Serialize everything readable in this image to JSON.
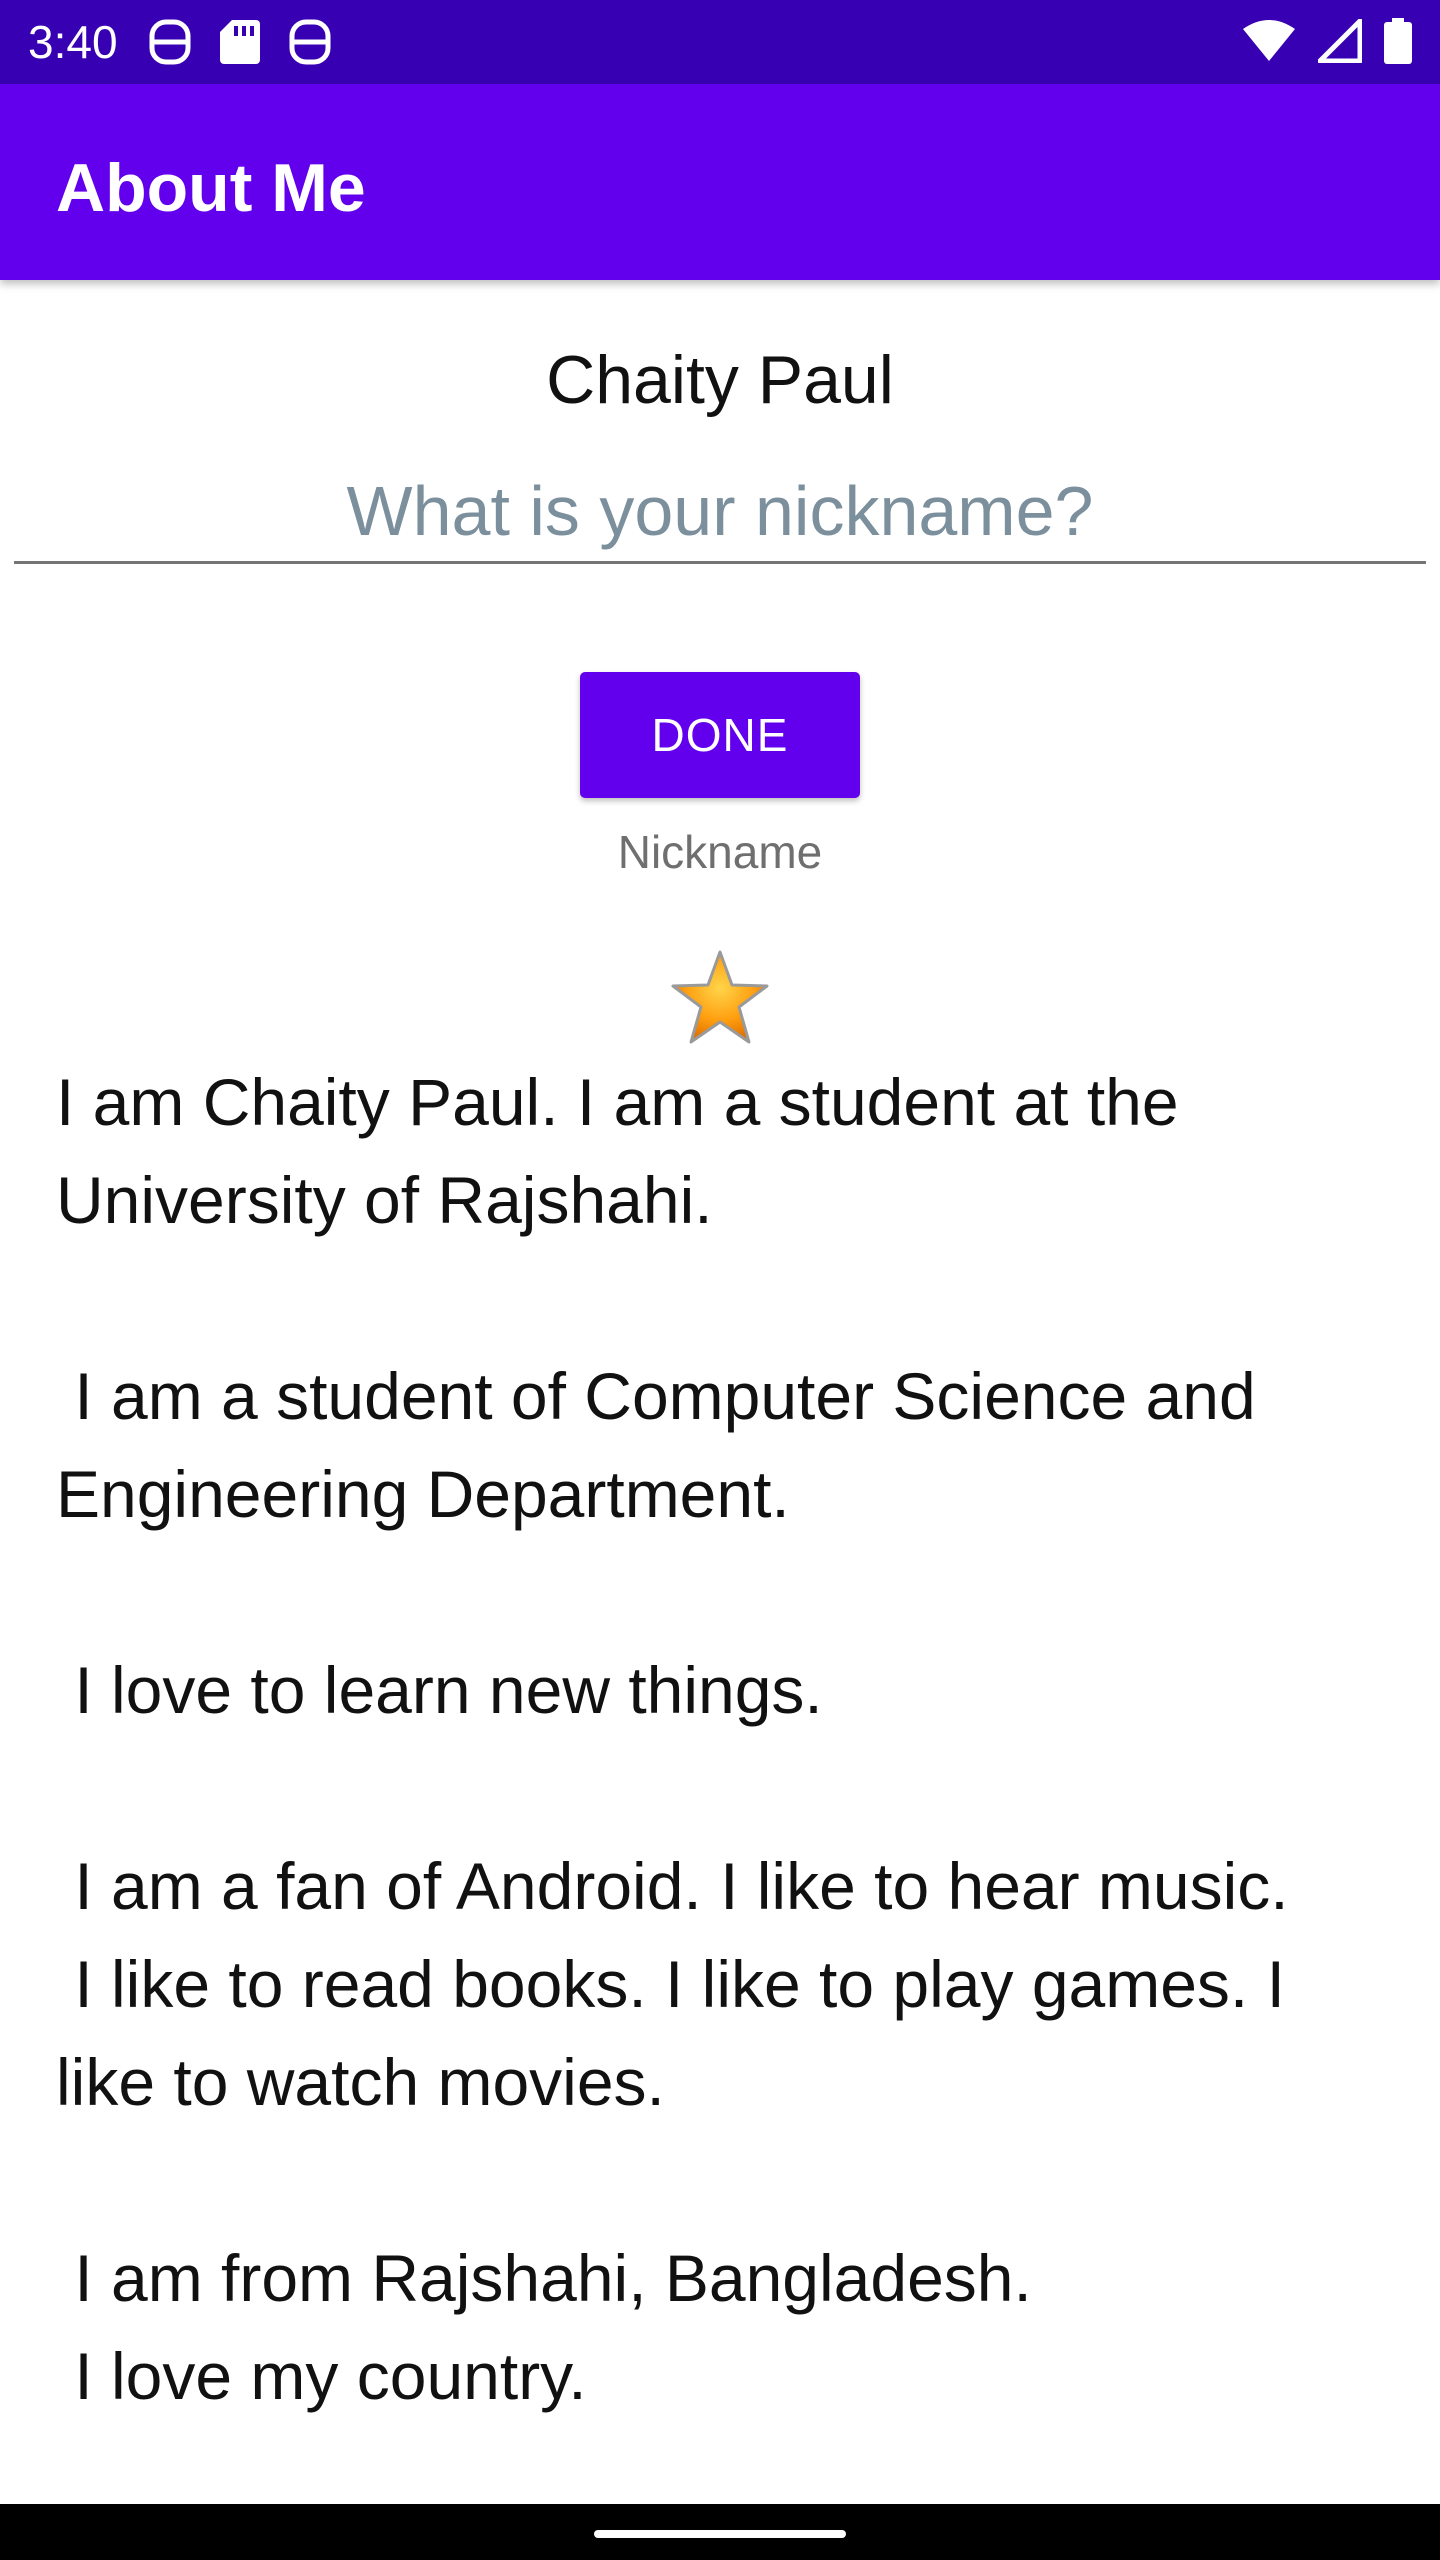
{
  "status_bar": {
    "time": "3:40",
    "notification_icons": [
      "device-check-icon",
      "sd-card-icon",
      "device-check-icon"
    ],
    "right_icons": [
      "wifi-icon",
      "cell-signal-icon",
      "battery-icon"
    ]
  },
  "app_bar": {
    "title": "About Me",
    "color": "#6200ee"
  },
  "profile": {
    "name": "Chaity Paul",
    "nickname_placeholder": "What is your nickname?",
    "nickname_value": "",
    "done_label": "DONE",
    "nickname_text": "Nickname",
    "star_icon": "star-icon"
  },
  "bio": "I am Chaity Paul. I am a student at the University of Rajshahi.\n\n I am a student of Computer Science and Engineering Department.\n\n I love to learn new things.\n\n I am a fan of Android. I like to hear music.\n I like to read books. I like to play games. I like to watch movies.\n\n I am from Rajshahi, Bangladesh.\n I love my country.",
  "colors": {
    "status_bar": "#3700b3",
    "primary": "#6200ee",
    "placeholder": "#7b8f9c"
  }
}
